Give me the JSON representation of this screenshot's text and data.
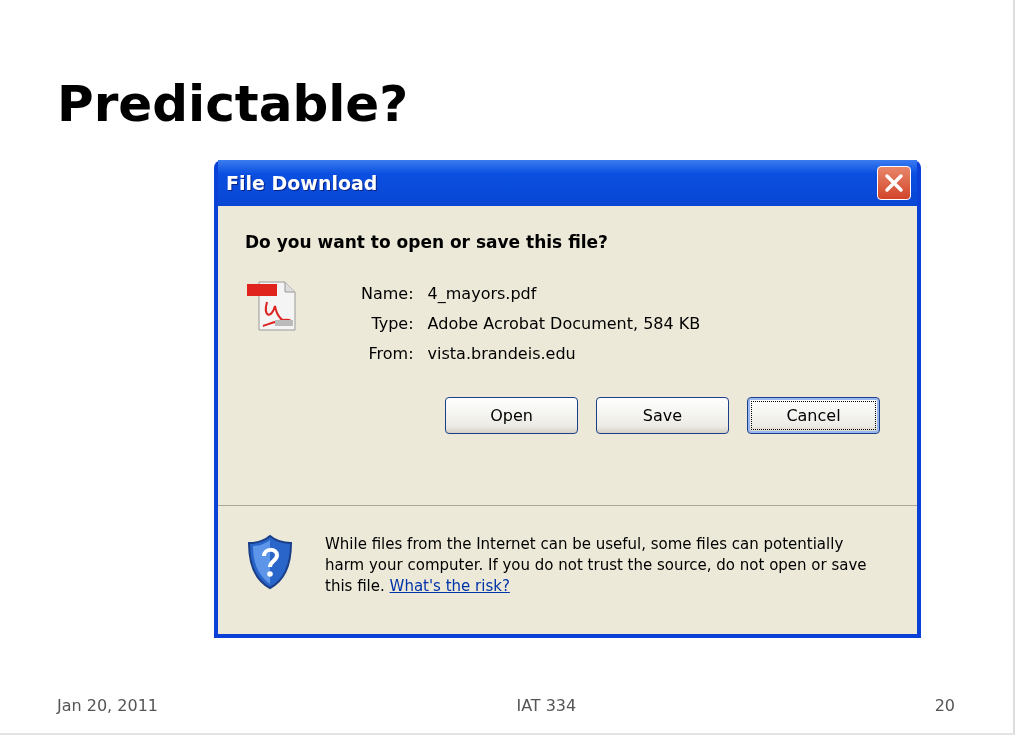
{
  "slide": {
    "title": "Predictable?",
    "footer": {
      "date": "Jan 20, 2011",
      "course": "IAT 334",
      "page": "20"
    }
  },
  "dialog": {
    "title": "File Download",
    "question": "Do you want to open or save this file?",
    "fields": [
      {
        "label": "Name:",
        "value": "4_mayors.pdf"
      },
      {
        "label": "Type:",
        "value": "Adobe Acrobat Document, 584 KB"
      },
      {
        "label": "From:",
        "value": "vista.brandeis.edu"
      }
    ],
    "buttons": [
      {
        "label": "Open",
        "focused": false
      },
      {
        "label": "Save",
        "focused": false
      },
      {
        "label": "Cancel",
        "focused": true
      }
    ],
    "warning": {
      "text": "While files from the Internet can be useful, some files can potentially harm your computer. If you do not trust the source, do not open or save this file.",
      "link": "What's the risk?"
    }
  }
}
